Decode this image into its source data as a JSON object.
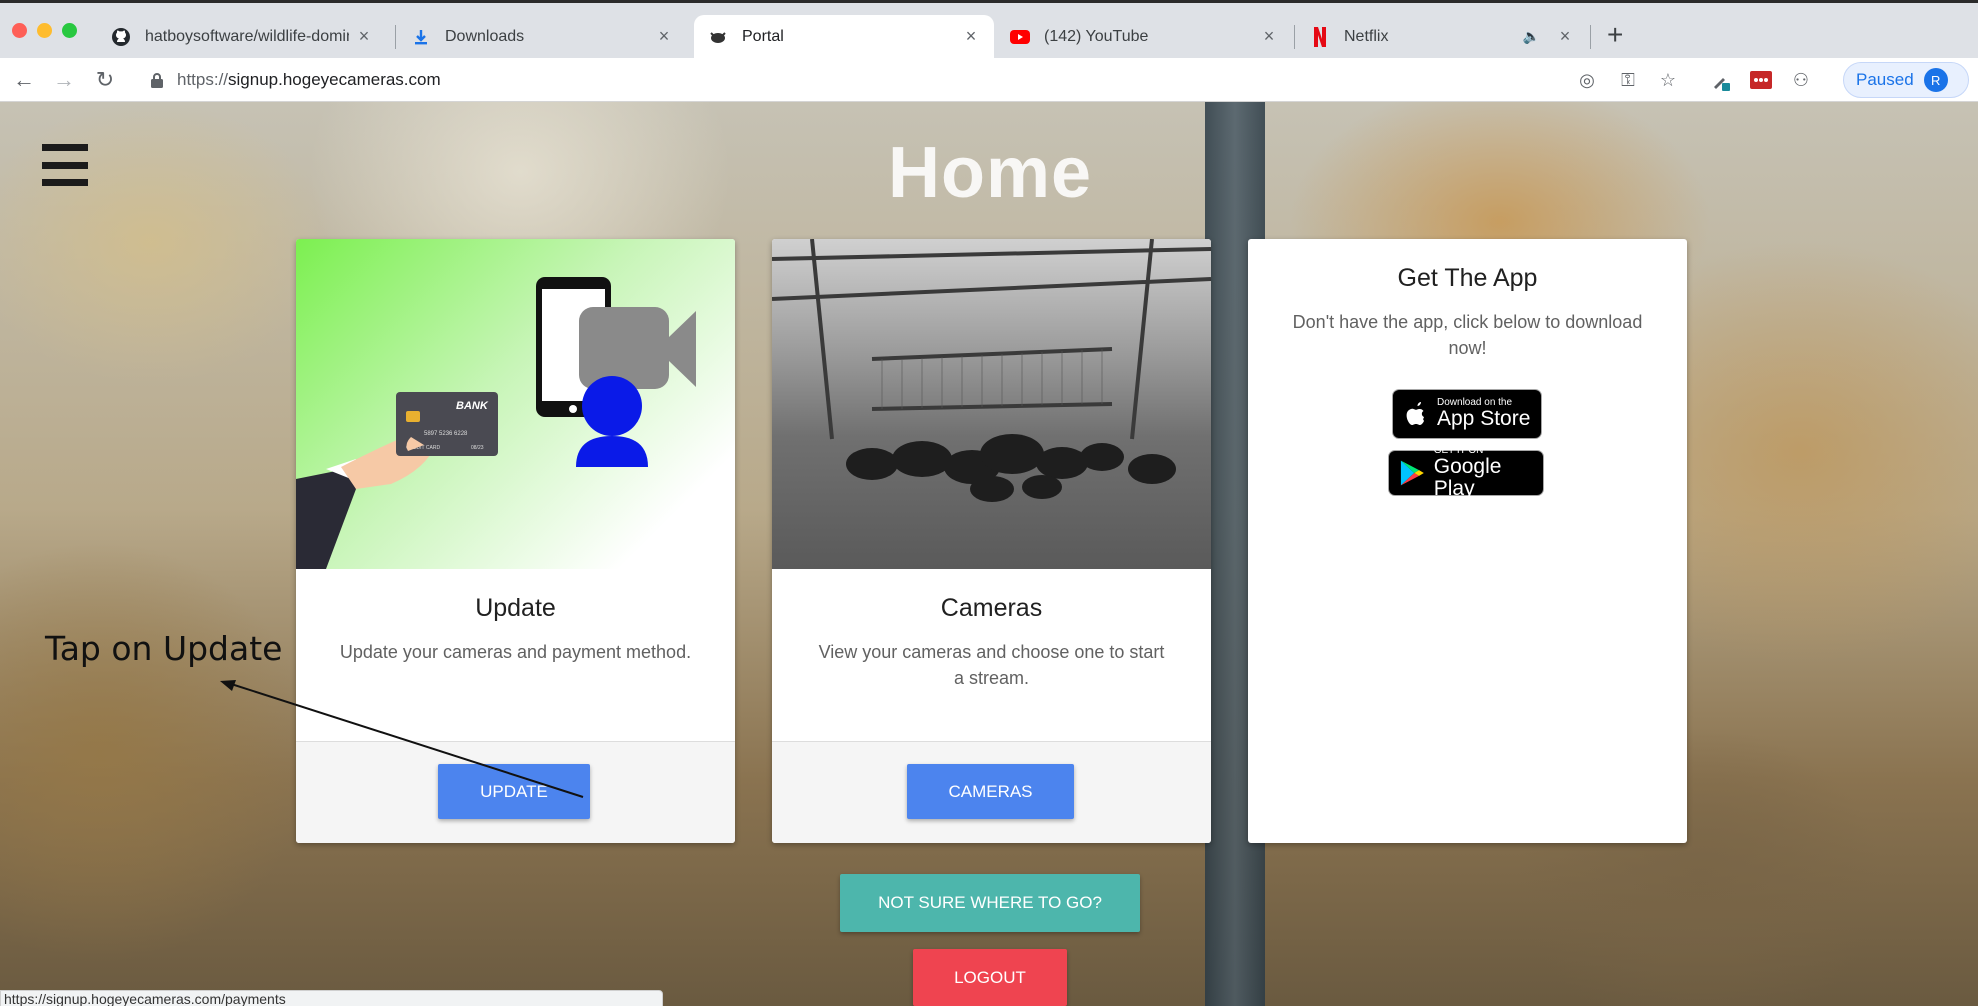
{
  "browser": {
    "tabs": [
      {
        "title": "hatboysoftware/wildlife-domin",
        "icon": "github-icon"
      },
      {
        "title": "Downloads",
        "icon": "download-icon"
      },
      {
        "title": "Portal",
        "icon": "hogeye-icon",
        "active": true
      },
      {
        "title": "(142) YouTube",
        "icon": "youtube-icon"
      },
      {
        "title": "Netflix",
        "icon": "netflix-icon",
        "audio": true
      }
    ],
    "url_scheme": "https://",
    "url_host": "signup.hogeyecameras.com",
    "profile_label": "Paused",
    "profile_initial": "R",
    "status_url": "https://signup.hogeyecameras.com/payments"
  },
  "page": {
    "title": "Home",
    "cards": {
      "update": {
        "title": "Update",
        "text": "Update your cameras and payment method.",
        "button": "UPDATE",
        "illustration_card_brand": "BANK",
        "illustration_card_digits": "5897  5236  6228",
        "illustration_card_name": "CREDIT CARD",
        "illustration_card_expiry": "08/23"
      },
      "cameras": {
        "title": "Cameras",
        "text": "View your cameras and choose one to start a stream.",
        "button": "CAMERAS"
      },
      "app": {
        "title": "Get The App",
        "text": "Don't have the app, click below to download now!",
        "appstore_small": "Download on the",
        "appstore_big": "App Store",
        "googleplay_small": "GET IT ON",
        "googleplay_big": "Google Play"
      }
    },
    "help_button": "NOT SURE WHERE TO GO?",
    "logout_button": "LOGOUT",
    "annotation": "Tap on Update"
  },
  "colors": {
    "accent_blue": "#4c84ee",
    "teal": "#4db6ac",
    "red": "#ef4450"
  }
}
